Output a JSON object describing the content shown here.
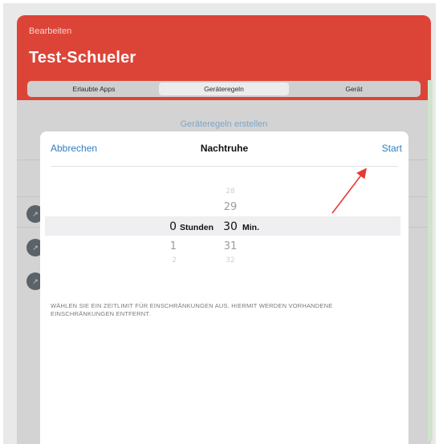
{
  "header": {
    "edit_label": "Bearbeiten",
    "title": "Test-Schueler",
    "color": "#dd4438"
  },
  "segments": [
    {
      "label": "Erlaubte Apps",
      "active": false
    },
    {
      "label": "Geräteregeln",
      "active": true
    },
    {
      "label": "Gerät",
      "active": false
    }
  ],
  "background": {
    "create_rules_label": "Geräteregeln erstellen",
    "item_icon": "device-icon"
  },
  "modal": {
    "cancel_label": "Abbrechen",
    "title": "Nachtruhe",
    "start_label": "Start",
    "accent": "#2f7fc1"
  },
  "picker": {
    "hours": {
      "selected": "0",
      "below1": "1",
      "below2": "2",
      "unit": "Stunden"
    },
    "minutes": {
      "above2": "28",
      "above1": "29",
      "selected": "30",
      "below1": "31",
      "below2": "32",
      "unit": "Min."
    }
  },
  "note": "WÄHLEN SIE EIN ZEITLIMIT FÜR EINSCHRÄNKUNGEN AUS. HIERMIT WERDEN VORHANDENE EINSCHRÄNKUNGEN ENTFERNT.",
  "annotation": {
    "arrow_color": "#e53935",
    "points_to": "start-button"
  }
}
